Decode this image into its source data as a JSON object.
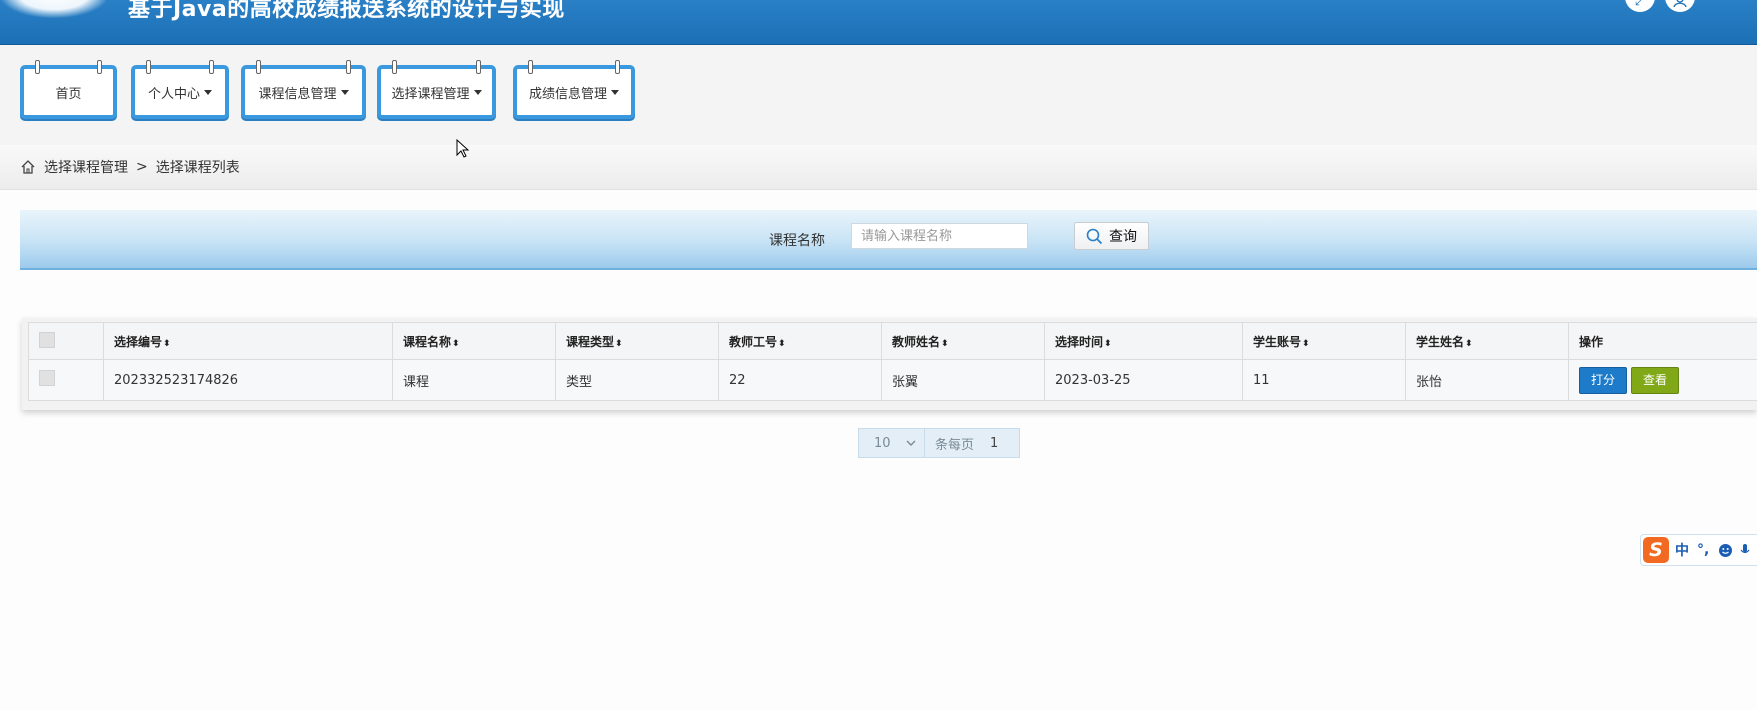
{
  "app": {
    "title": "基于Java的高校成绩报送系统的设计与实现"
  },
  "topbar": {
    "icons": [
      "fullscreen-icon",
      "user-icon"
    ]
  },
  "nav": {
    "items": [
      {
        "label": "首页",
        "dropdown": false
      },
      {
        "label": "个人中心",
        "dropdown": true
      },
      {
        "label": "课程信息管理",
        "dropdown": true
      },
      {
        "label": "选择课程管理",
        "dropdown": true
      },
      {
        "label": "成绩信息管理",
        "dropdown": true
      }
    ]
  },
  "breadcrumb": {
    "parent": "选择课程管理",
    "separator": ">",
    "current": "选择课程列表"
  },
  "search": {
    "label": "课程名称",
    "placeholder": "请输入课程名称",
    "value": "",
    "button_label": "查询"
  },
  "table": {
    "columns": [
      "选择编号",
      "课程名称",
      "课程类型",
      "教师工号",
      "教师姓名",
      "选择时间",
      "学生账号",
      "学生姓名",
      "操作"
    ],
    "sort_glyph": "⬍",
    "rows": [
      {
        "id": "202332523174826",
        "course_name": "课程",
        "course_type": "类型",
        "teacher_no": "22",
        "teacher_name": "张翼",
        "time": "2023-03-25",
        "student_account": "11",
        "student_name": "张怡"
      }
    ],
    "actions": {
      "score": "打分",
      "view": "查看"
    }
  },
  "pager": {
    "page_size": "10",
    "per_page_label": "条每页",
    "current_page": "1"
  },
  "ime": {
    "logo": "S",
    "mode": "中",
    "punct": "°,"
  },
  "colors": {
    "primary": "#1e7bc9",
    "view_button": "#80a817",
    "nav_border": "#3a98de"
  }
}
